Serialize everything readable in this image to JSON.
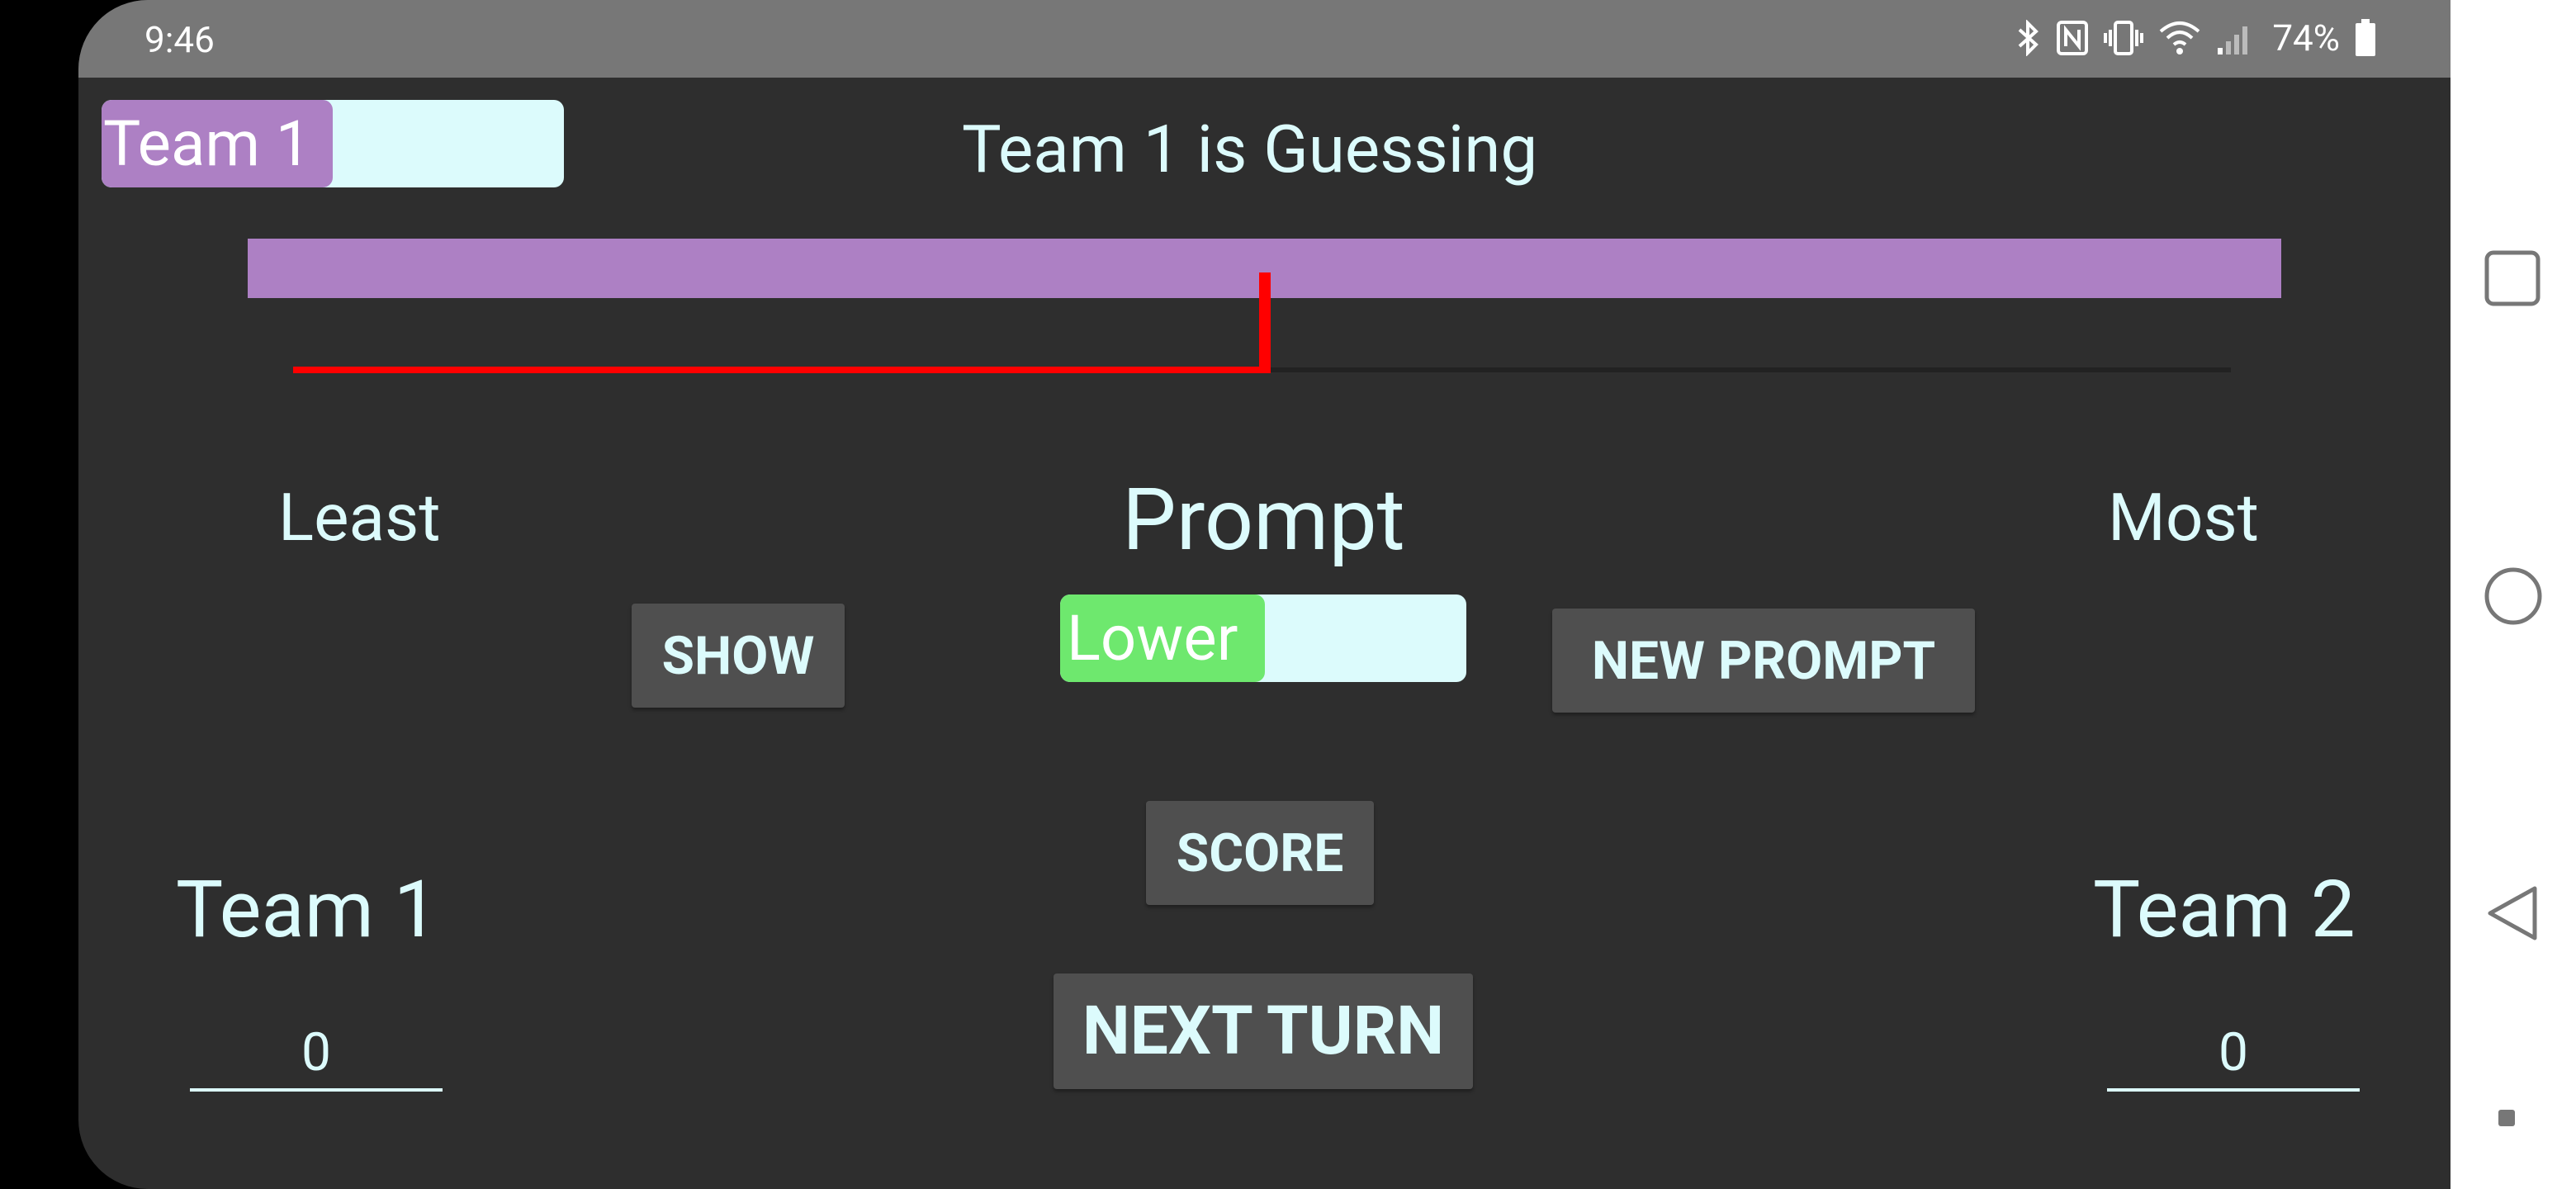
{
  "status_bar": {
    "time": "9:46",
    "battery_percent": "74%",
    "icons": [
      "bluetooth-icon",
      "nfc-icon",
      "vibrate-icon",
      "wifi-icon",
      "signal-icon",
      "battery-icon"
    ]
  },
  "header": {
    "team_toggle_label": "Team 1",
    "guessing_text": "Team 1 is Guessing"
  },
  "dial": {
    "left_label": "Least",
    "right_label": "Most",
    "slider_value_fraction": 0.5
  },
  "prompt": {
    "title": "Prompt",
    "toggle_label": "Lower",
    "show_button": "SHOW",
    "new_prompt_button": "NEW PROMPT"
  },
  "actions": {
    "score_button": "SCORE",
    "next_turn_button": "NEXT TURN"
  },
  "teams": {
    "team1": {
      "name": "Team 1",
      "score": "0"
    },
    "team2": {
      "name": "Team 2",
      "score": "0"
    }
  },
  "colors": {
    "background": "#2e2e2e",
    "accent_purple": "#ad80c4",
    "accent_green": "#6ee86e",
    "slider_red": "#ff0000",
    "text": "#dcfbfc"
  },
  "nav_bar": {
    "icons": [
      "recent-apps-icon",
      "home-icon",
      "back-icon",
      "assist-dot-icon"
    ]
  }
}
